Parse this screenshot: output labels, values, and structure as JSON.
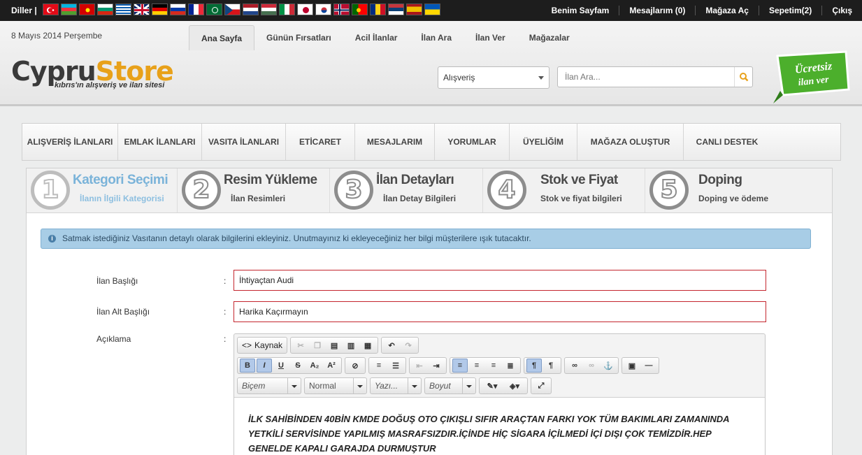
{
  "topbar": {
    "languages_label": "Diller  |",
    "flags": [
      "tr",
      "az",
      "mk",
      "bg",
      "gr",
      "gb",
      "de",
      "ru",
      "fr",
      "sa",
      "cz",
      "nl",
      "hu",
      "it",
      "jp",
      "kr",
      "no",
      "pt",
      "ro",
      "rs",
      "es",
      "ua"
    ],
    "nav": [
      "Benim Sayfam",
      "Mesajlarım (0)",
      "Mağaza Aç",
      "Sepetim(2)",
      "Çıkış"
    ]
  },
  "header": {
    "date": "8 Mayıs 2014 Perşembe",
    "tabs": [
      "Ana Sayfa",
      "Günün Fırsatları",
      "Acil İlanlar",
      "İlan Ara",
      "İlan Ver",
      "Mağazalar"
    ],
    "active_tab": "Ana Sayfa",
    "logo_main_a": "Cypru",
    "logo_main_b": "Store",
    "logo_tagline": "kıbrıs'ın alışveriş ve ilan sitesi",
    "category_select": "Alışveriş",
    "search_placeholder": "İlan Ara...",
    "free_badge_line1": "Ücretsiz",
    "free_badge_line2": "ilan ver"
  },
  "mainnav": [
    "ALIŞVERİŞ İLANLARI",
    "EMLAK İLANLARI",
    "VASITA İLANLARI",
    "ETİCARET",
    "MESAJLARIM",
    "YORUMLAR",
    "ÜYELİĞİM",
    "MAĞAZA OLUŞTUR",
    "CANLI DESTEK"
  ],
  "steps": [
    {
      "num": "1",
      "title": "Kategori Seçimi",
      "sub": "İlanın İlgili Kategorisi",
      "active": true
    },
    {
      "num": "2",
      "title": "Resim Yükleme",
      "sub": "İlan Resimleri",
      "active": false
    },
    {
      "num": "3",
      "title": "İlan Detayları",
      "sub": "İlan Detay Bilgileri",
      "active": false
    },
    {
      "num": "4",
      "title": "Stok ve Fiyat",
      "sub": "Stok ve fiyat bilgileri",
      "active": false
    },
    {
      "num": "5",
      "title": "Doping",
      "sub": "Doping ve ödeme",
      "active": false
    }
  ],
  "info_message": "Satmak istediğiniz Vasıtanın detaylı olarak bilgilerini ekleyiniz. Unutmayınız ki ekleyeceğiniz her bilgi müşterilere ışık tutacaktır.",
  "form": {
    "title_label": "İlan Başlığı",
    "title_value": "İhtiyaçtan Audi",
    "subtitle_label": "İlan Alt Başlığı",
    "subtitle_value": "Harika Kaçırmayın",
    "description_label": "Açıklama",
    "colon": ":"
  },
  "editor": {
    "source_label": "Kaynak",
    "format_combo": "Biçem",
    "paragraph_combo": "Normal",
    "font_combo": "Yazı...",
    "size_combo": "Boyut",
    "content": "İLK SAHİBİNDEN 40BİN KMDE DOĞUŞ OTO ÇIKIŞLI SIFIR ARAÇTAN FARKI YOK TÜM BAKIMLARI ZAMANINDA YETKİLİ SERVİSİNDE YAPILMIŞ MASRAFSIZDIR.İÇİNDE HİÇ SİGARA İÇİLMEDİ İÇİ DIŞI ÇOK TEMİZDİR.HEP GENELDE KAPALI GARAJDA DURMUŞTUR"
  },
  "colors": {
    "topbar": "#1d1d1d",
    "accent_orange": "#e8a11a",
    "active_step": "#7ab3d9",
    "info_bg": "#a8cde6",
    "required_border": "#c4262e",
    "badge_green": "#4caf2c"
  }
}
